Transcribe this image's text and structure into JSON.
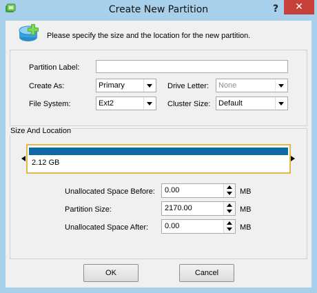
{
  "window": {
    "title": "Create New Partition",
    "help_label": "?",
    "close_label": "✕"
  },
  "header": {
    "instruction": "Please specify the size and the location for the new partition."
  },
  "form": {
    "partition_label_caption": "Partition Label:",
    "partition_label_value": "",
    "create_as_caption": "Create As:",
    "create_as_value": "Primary",
    "drive_letter_caption": "Drive Letter:",
    "drive_letter_value": "None",
    "file_system_caption": "File System:",
    "file_system_value": "Ext2",
    "cluster_size_caption": "Cluster Size:",
    "cluster_size_value": "Default"
  },
  "size_location": {
    "group_title": "Size And Location",
    "disk_size_label": "2.12 GB",
    "unallocated_before_caption": "Unallocated Space Before:",
    "unallocated_before_value": "0.00",
    "partition_size_caption": "Partition Size:",
    "partition_size_value": "2170.00",
    "unallocated_after_caption": "Unallocated Space After:",
    "unallocated_after_value": "0.00",
    "unit": "MB"
  },
  "buttons": {
    "ok_label": "OK",
    "cancel_label": "Cancel"
  },
  "colors": {
    "frame": "#a8d0ea",
    "close_button": "#c7413a",
    "partition_bar": "#0d6aa7",
    "disk_map_border": "#e0b948"
  },
  "icons": {
    "title_icon": "partition-app-icon",
    "header_icon": "new-partition-disk-icon"
  }
}
